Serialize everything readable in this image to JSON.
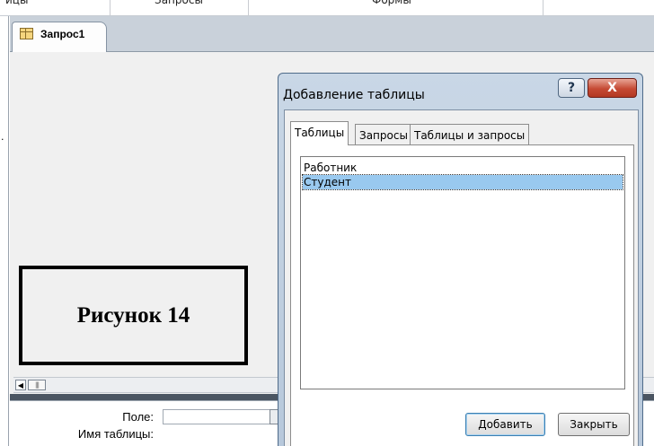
{
  "ribbon": {
    "partial_labels": [
      "ицы",
      "Запросы",
      "Формы"
    ]
  },
  "document": {
    "tab_label": "Запрос1",
    "left_pane_mark": "."
  },
  "caption": {
    "text": "Рисунок 14"
  },
  "design_grid": {
    "row_labels": [
      "Поле:",
      "Имя таблицы:"
    ]
  },
  "dialog": {
    "title": "Добавление таблицы",
    "help_label": "?",
    "close_label": "X",
    "tabs": [
      {
        "label": "Таблицы",
        "active": true
      },
      {
        "label": "Запросы",
        "active": false
      },
      {
        "label": "Таблицы и запросы",
        "active": false
      }
    ],
    "list_items": [
      {
        "label": "Работник",
        "selected": false
      },
      {
        "label": "Студент",
        "selected": true
      }
    ],
    "add_button": "Добавить",
    "close_button": "Закрыть"
  },
  "colors": {
    "selection": "#99c9ef",
    "close_button": "#c54a34",
    "splitter": "#4b5562"
  }
}
